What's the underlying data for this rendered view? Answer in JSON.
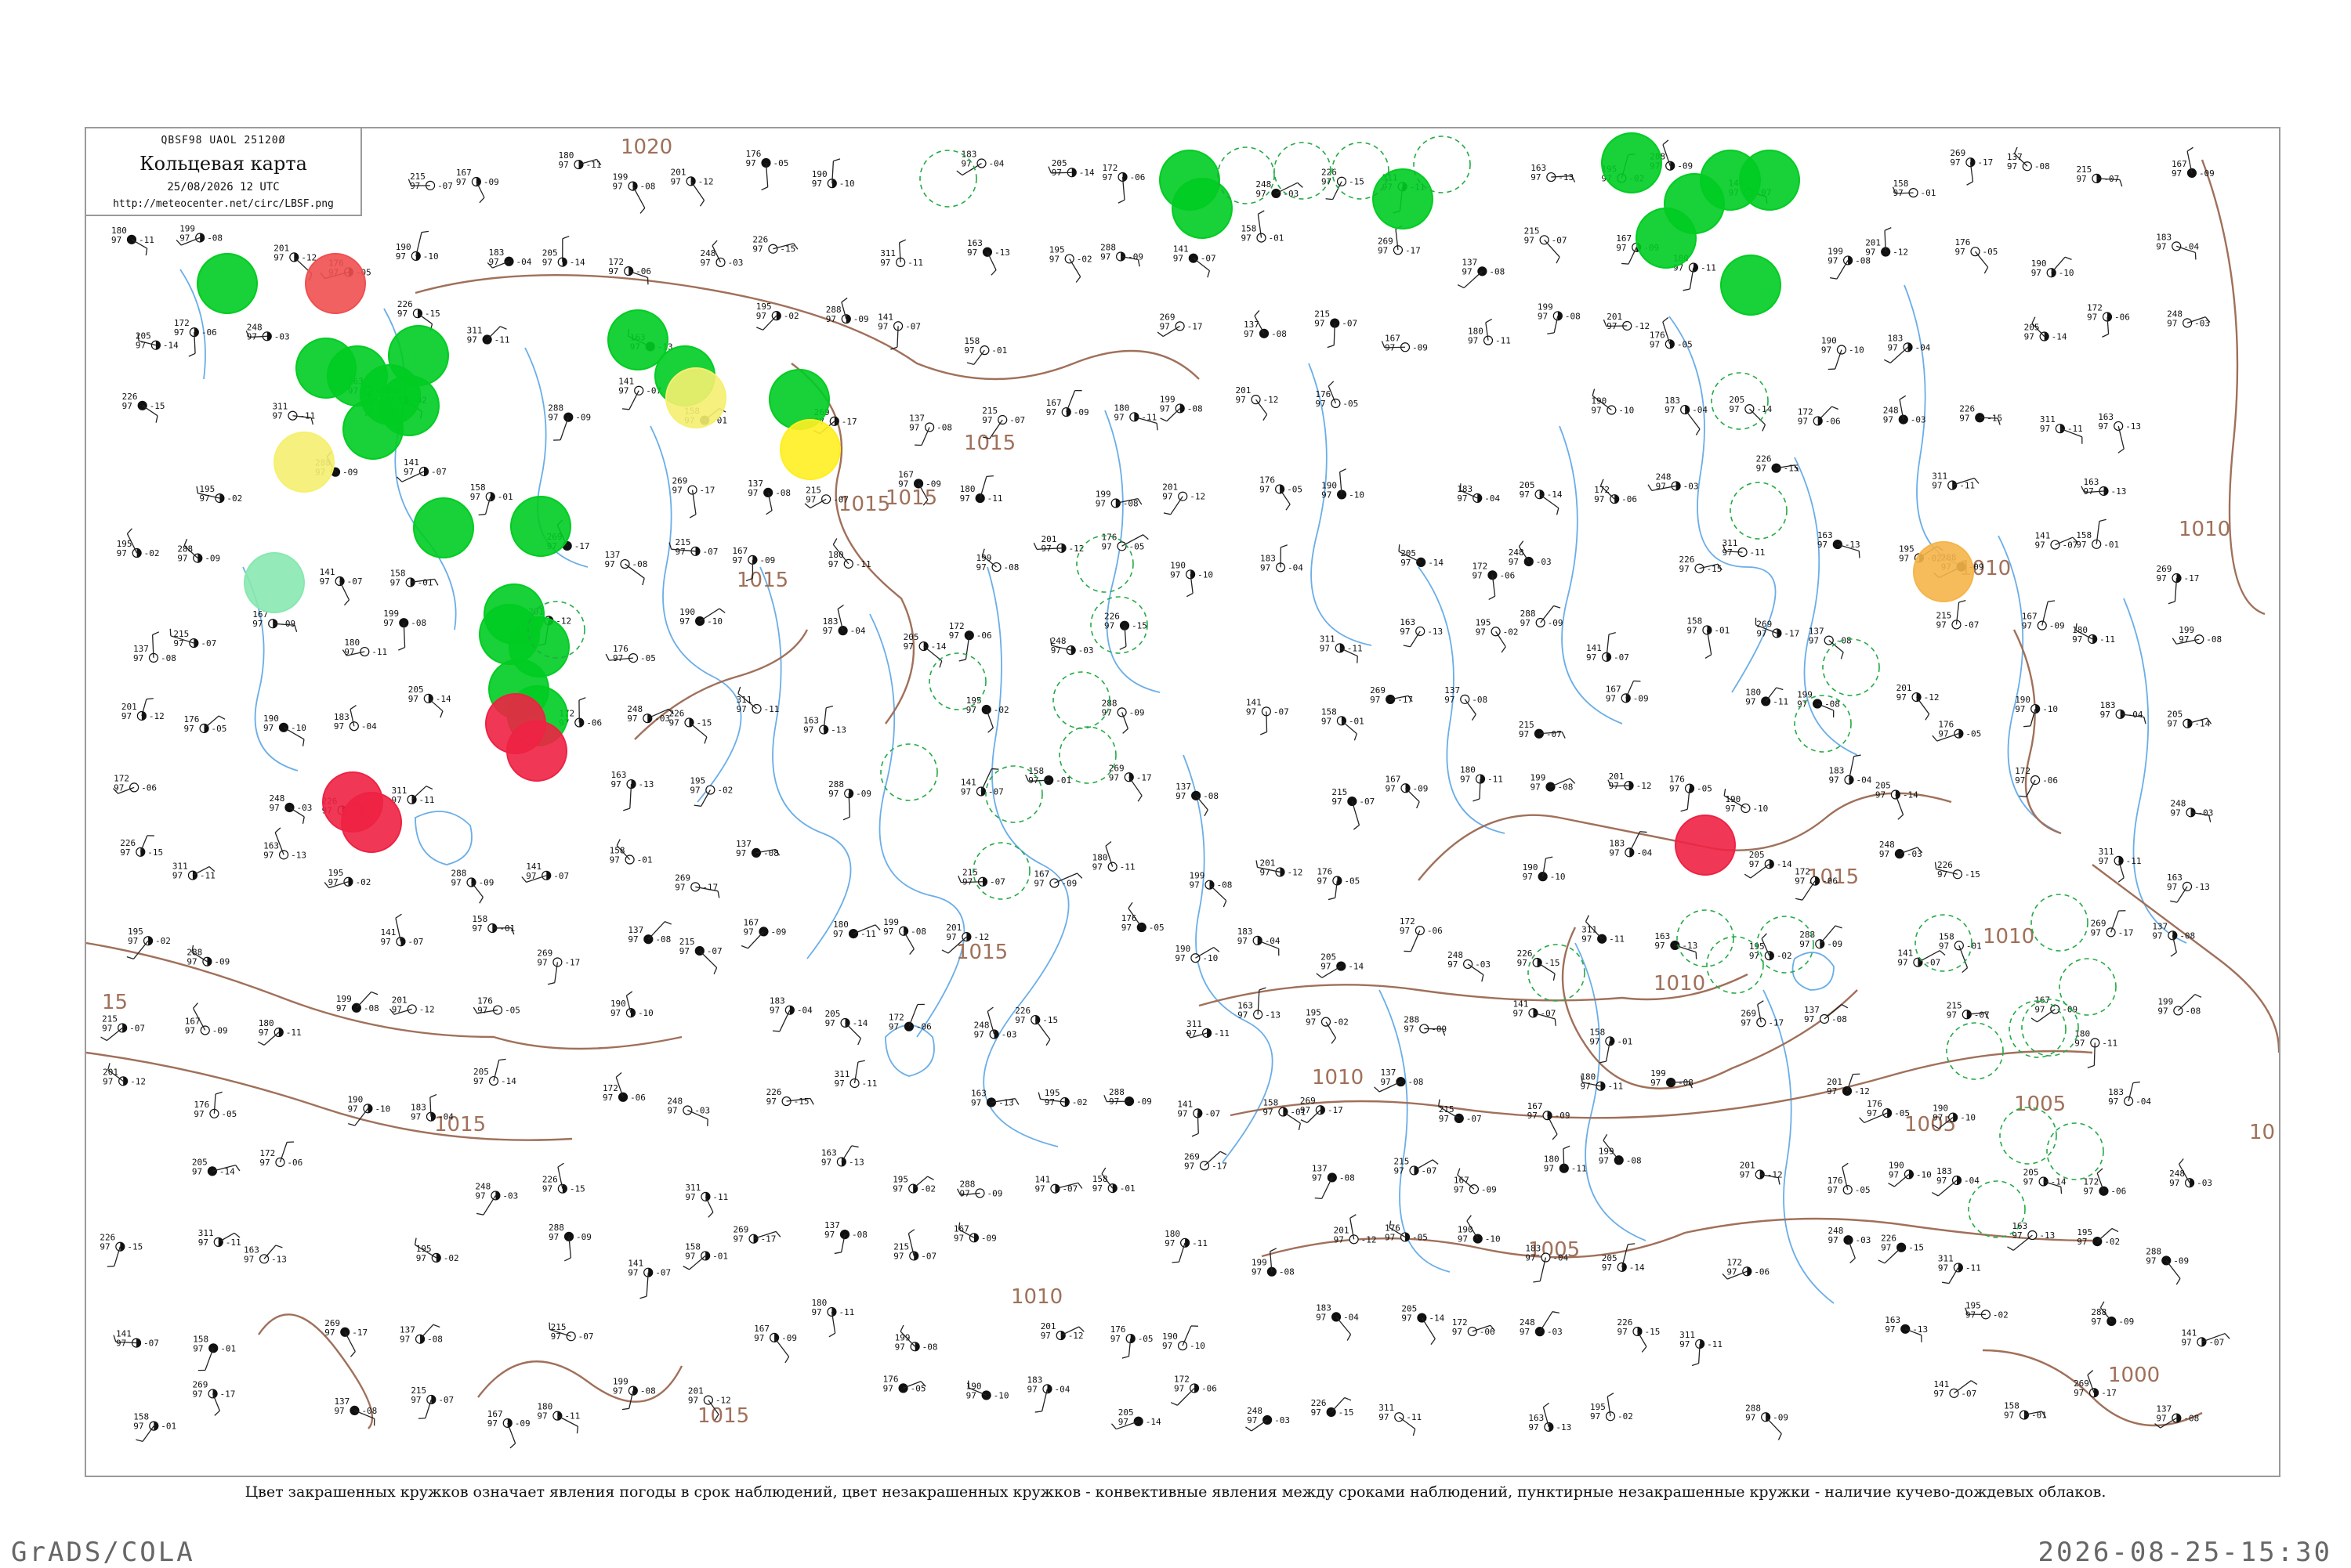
{
  "header": {
    "code": "QBSF98  UAOL  25120Ø",
    "title": "Кольцевая карта",
    "datetime": "25/08/2026 12 UTC",
    "url": "http://meteocenter.net/circ/LBSF.png"
  },
  "legend_note": "Цвет закрашенных кружков означает явления погоды в срок наблюдений, цвет незакрашенных кружков - конвективные явления между сроками наблюдений, пунктирные незакрашенные кружки - наличие кучево-дождевых облаков.",
  "footer": {
    "left": "GrADS/COLA",
    "right": "2026-08-25-15:30"
  },
  "colors": {
    "isobar": "#a0705a",
    "river": "#6aaee8",
    "precip_green": "#00cc22",
    "thunder_red": "#ee2244",
    "warm_red": "#f05050",
    "fog_yellow": "#ffee22",
    "haze_yellow": "#f5f070",
    "orange": "#f5b54a",
    "mint": "#88e8b0",
    "convective_ring": "#22aa44"
  },
  "isobar_labels": [
    "1020",
    "1015",
    "1015",
    "1015",
    "1015",
    "1015",
    "1015",
    "1015",
    "1010",
    "1010",
    "1010",
    "1010",
    "1010",
    "1010",
    "1005",
    "1005",
    "1005",
    "1000",
    "1015",
    "15",
    "10"
  ],
  "station_samples": [
    {
      "t": "215",
      "p": "97",
      "v": "-07"
    },
    {
      "t": "167",
      "p": "97",
      "v": "-09"
    },
    {
      "t": "180",
      "p": "97",
      "v": "-11"
    },
    {
      "t": "199",
      "p": "97",
      "v": "-08"
    },
    {
      "t": "201",
      "p": "97",
      "v": "-12"
    },
    {
      "t": "176",
      "p": "97",
      "v": "-05"
    },
    {
      "t": "190",
      "p": "97",
      "v": "-10"
    },
    {
      "t": "183",
      "p": "97",
      "v": "-04"
    },
    {
      "t": "205",
      "p": "97",
      "v": "-14"
    },
    {
      "t": "172",
      "p": "97",
      "v": "-06"
    },
    {
      "t": "248",
      "p": "97",
      "v": "-03"
    },
    {
      "t": "226",
      "p": "97",
      "v": "-15"
    },
    {
      "t": "311",
      "p": "97",
      "v": "-11"
    },
    {
      "t": "163",
      "p": "97",
      "v": "-13"
    },
    {
      "t": "195",
      "p": "97",
      "v": "-02"
    },
    {
      "t": "288",
      "p": "97",
      "v": "-09"
    },
    {
      "t": "141",
      "p": "97",
      "v": "-07"
    },
    {
      "t": "158",
      "p": "97",
      "v": "-01"
    },
    {
      "t": "269",
      "p": "97",
      "v": "-17"
    },
    {
      "t": "137",
      "p": "97",
      "v": "-08"
    }
  ]
}
